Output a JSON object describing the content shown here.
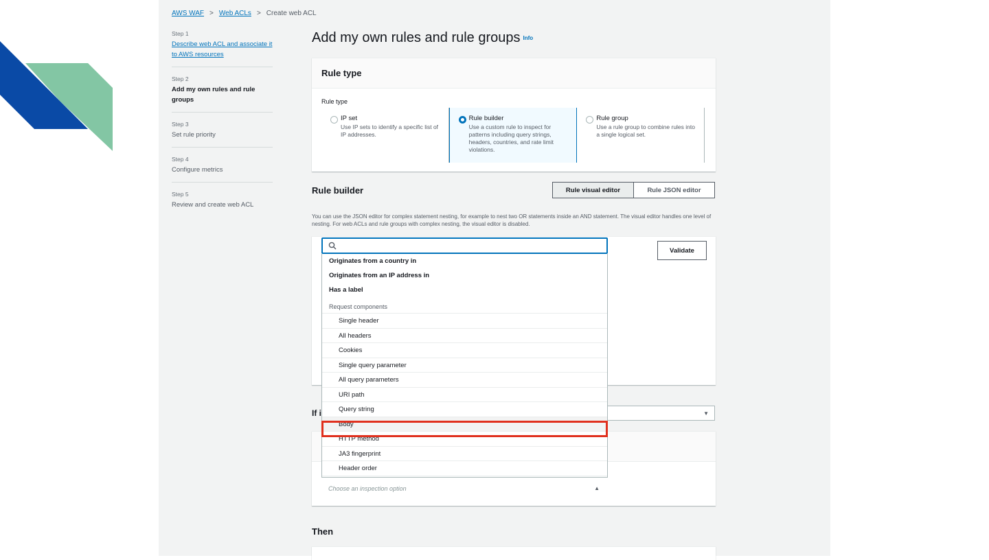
{
  "breadcrumb": {
    "item1": "AWS WAF",
    "item2": "Web ACLs",
    "item3": "Create web ACL",
    "sep": ">"
  },
  "steps": [
    {
      "num": "Step 1",
      "title": "Describe web ACL and associate it to AWS resources"
    },
    {
      "num": "Step 2",
      "title": "Add my own rules and rule groups"
    },
    {
      "num": "Step 3",
      "title": "Set rule priority"
    },
    {
      "num": "Step 4",
      "title": "Configure metrics"
    },
    {
      "num": "Step 5",
      "title": "Review and create web ACL"
    }
  ],
  "page": {
    "title": "Add my own rules and rule groups",
    "info": "Info"
  },
  "rule_type": {
    "header": "Rule type",
    "label": "Rule type",
    "tiles": [
      {
        "title": "IP set",
        "desc": "Use IP sets to identify a specific list of IP addresses."
      },
      {
        "title": "Rule builder",
        "desc": "Use a custom rule to inspect for patterns including query strings, headers, countries, and rate limit violations."
      },
      {
        "title": "Rule group",
        "desc": "Use a rule group to combine rules into a single logical set."
      }
    ]
  },
  "rule_builder": {
    "title": "Rule builder",
    "visual_editor": "Rule visual editor",
    "json_editor": "Rule JSON editor",
    "description": "You can use the JSON editor for complex statement nesting, for example to nest two OR statements inside an AND statement. The visual editor handles one level of nesting. For web ACLs and rule groups with complex nesting, the visual editor is disabled.",
    "validate": "Validate",
    "search_value": ""
  },
  "dropdown": {
    "top_items": [
      "Originates from a country in",
      "Originates from an IP address in",
      "Has a label"
    ],
    "group_label": "Request components",
    "sub_items": [
      "Single header",
      "All headers",
      "Cookies",
      "Single query parameter",
      "All query parameters",
      "URI path",
      "Query string",
      "Body",
      "HTTP method",
      "JA3 fingerprint",
      "Header order"
    ]
  },
  "if_label": "If i",
  "inspect_placeholder": "Choose an inspection option",
  "then_label": "Then",
  "colors": {
    "accent": "#0073bb",
    "highlight": "#e0301e",
    "deco_blue": "#0a4aa6",
    "deco_green": "#83c6a4"
  }
}
